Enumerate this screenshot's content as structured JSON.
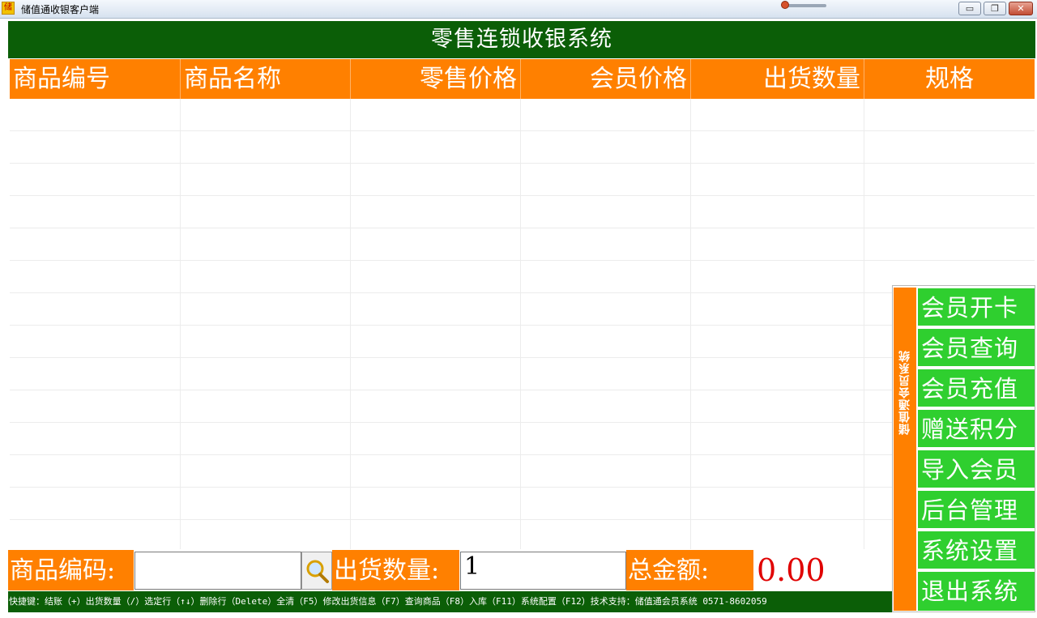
{
  "window": {
    "title": "储值通收银客户端",
    "icon_glyph": "储",
    "min_glyph": "▭",
    "max_glyph": "❐",
    "close_glyph": "✕"
  },
  "header": {
    "title": "零售连锁收银系统"
  },
  "grid": {
    "columns": [
      "商品编号",
      "商品名称",
      "零售价格",
      "会员价格",
      "出货数量",
      "规格"
    ],
    "rows": []
  },
  "side_panel": {
    "title": "储值通会员系统",
    "buttons": [
      "会员开卡",
      "会员查询",
      "会员充值",
      "赠送积分",
      "导入会员",
      "后台管理",
      "系统设置",
      "退出系统"
    ]
  },
  "bottom": {
    "code_label": "商品编码:",
    "code_value": "",
    "qty_label": "出货数量:",
    "qty_value": "1",
    "total_label": "总金额:",
    "total_value": "0.00"
  },
  "status_bar": {
    "text": "快捷键：结账（+）出货数量（/）选定行（↑↓）删除行（Delete）全清（F5）修改出货信息（F7）查询商品（F8）入库（F11）系统配置（F12）技术支持：储值通会员系统 0571-8602059"
  },
  "colors": {
    "header_green": "#0b5e07",
    "orange": "#ff8000",
    "button_green": "#2fcf2f",
    "total_red": "#e00000"
  },
  "icons": {
    "search": "magnifier-icon"
  }
}
